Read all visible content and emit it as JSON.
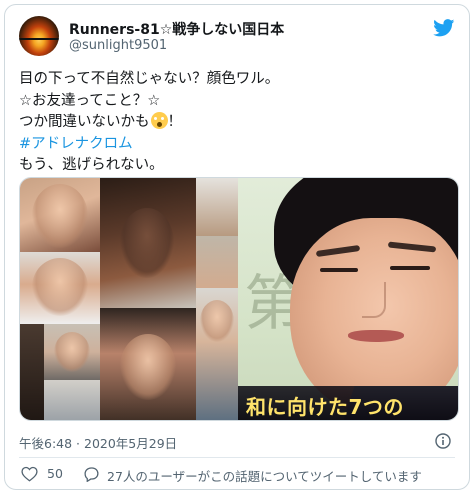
{
  "tweet": {
    "author": {
      "display_name": "Runners-81☆戦争しない国日本",
      "handle": "@sunlight9501"
    },
    "text_lines": [
      {
        "text": "目の下って不自然じゃない？顔色ワル。"
      },
      {
        "text": "☆お友達ってこと？☆"
      },
      {
        "text": "つか間違いないかも",
        "emoji": "face-screaming-icon",
        "after": "！"
      },
      {
        "hashtag": "#アドレナクロム"
      },
      {
        "text": "もう、逃げられない。"
      }
    ],
    "media": {
      "caption_text": "和に向けた7つの"
    },
    "timestamp": "午後6:48 · 2020年5月29日",
    "like_count": "50",
    "discussion_text": "27人のユーザーがこの話題についてツイートしています"
  },
  "colors": {
    "twitter_blue": "#1da1f2",
    "hashtag": "#1b95e0",
    "secondary_text": "#536471",
    "caption": "#ffe36b"
  },
  "icons": {
    "brand": "twitter-bird-icon",
    "info": "info-icon",
    "like": "heart-icon",
    "discussion": "speech-bubble-icon"
  }
}
